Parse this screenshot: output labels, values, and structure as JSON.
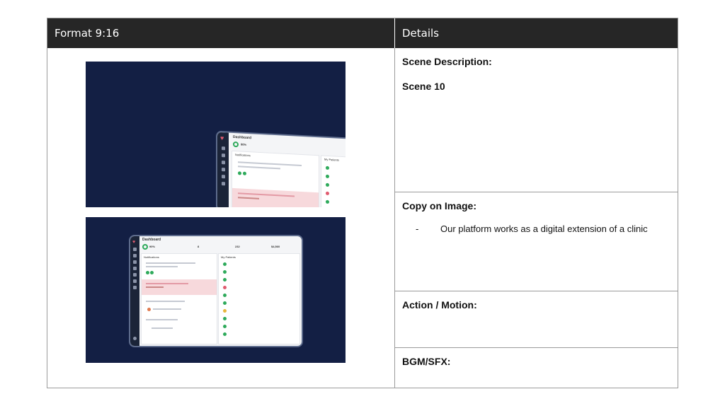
{
  "table": {
    "left_header": "Format 9:16",
    "right_header": "Details",
    "scene_description_label": "Scene Description:",
    "scene_value": "Scene 10",
    "copy_on_image_label": "Copy on Image:",
    "copy_bullet": "-",
    "copy_text": "Our platform works as a digital extension of a clinic",
    "action_motion_label": "Action / Motion:",
    "bgm_sfx_label": "BGM/SFX:"
  },
  "frame1": {
    "app_title": "Dashboard",
    "stat": "90%",
    "notifications_label": "Notifications",
    "patients_label": "My Patients"
  },
  "frame2": {
    "app_title": "Dashboard",
    "stats": [
      "90%",
      "8",
      "232",
      "$4,560"
    ],
    "notifications_label": "Notifications",
    "patients_label": "My Patients"
  },
  "colors": {
    "header_bg": "#262626",
    "frame_bg": "#131f44",
    "accent_green": "#2eaa5b",
    "alert_pink": "#f7d9dc",
    "heart_red": "#e05b6f"
  }
}
